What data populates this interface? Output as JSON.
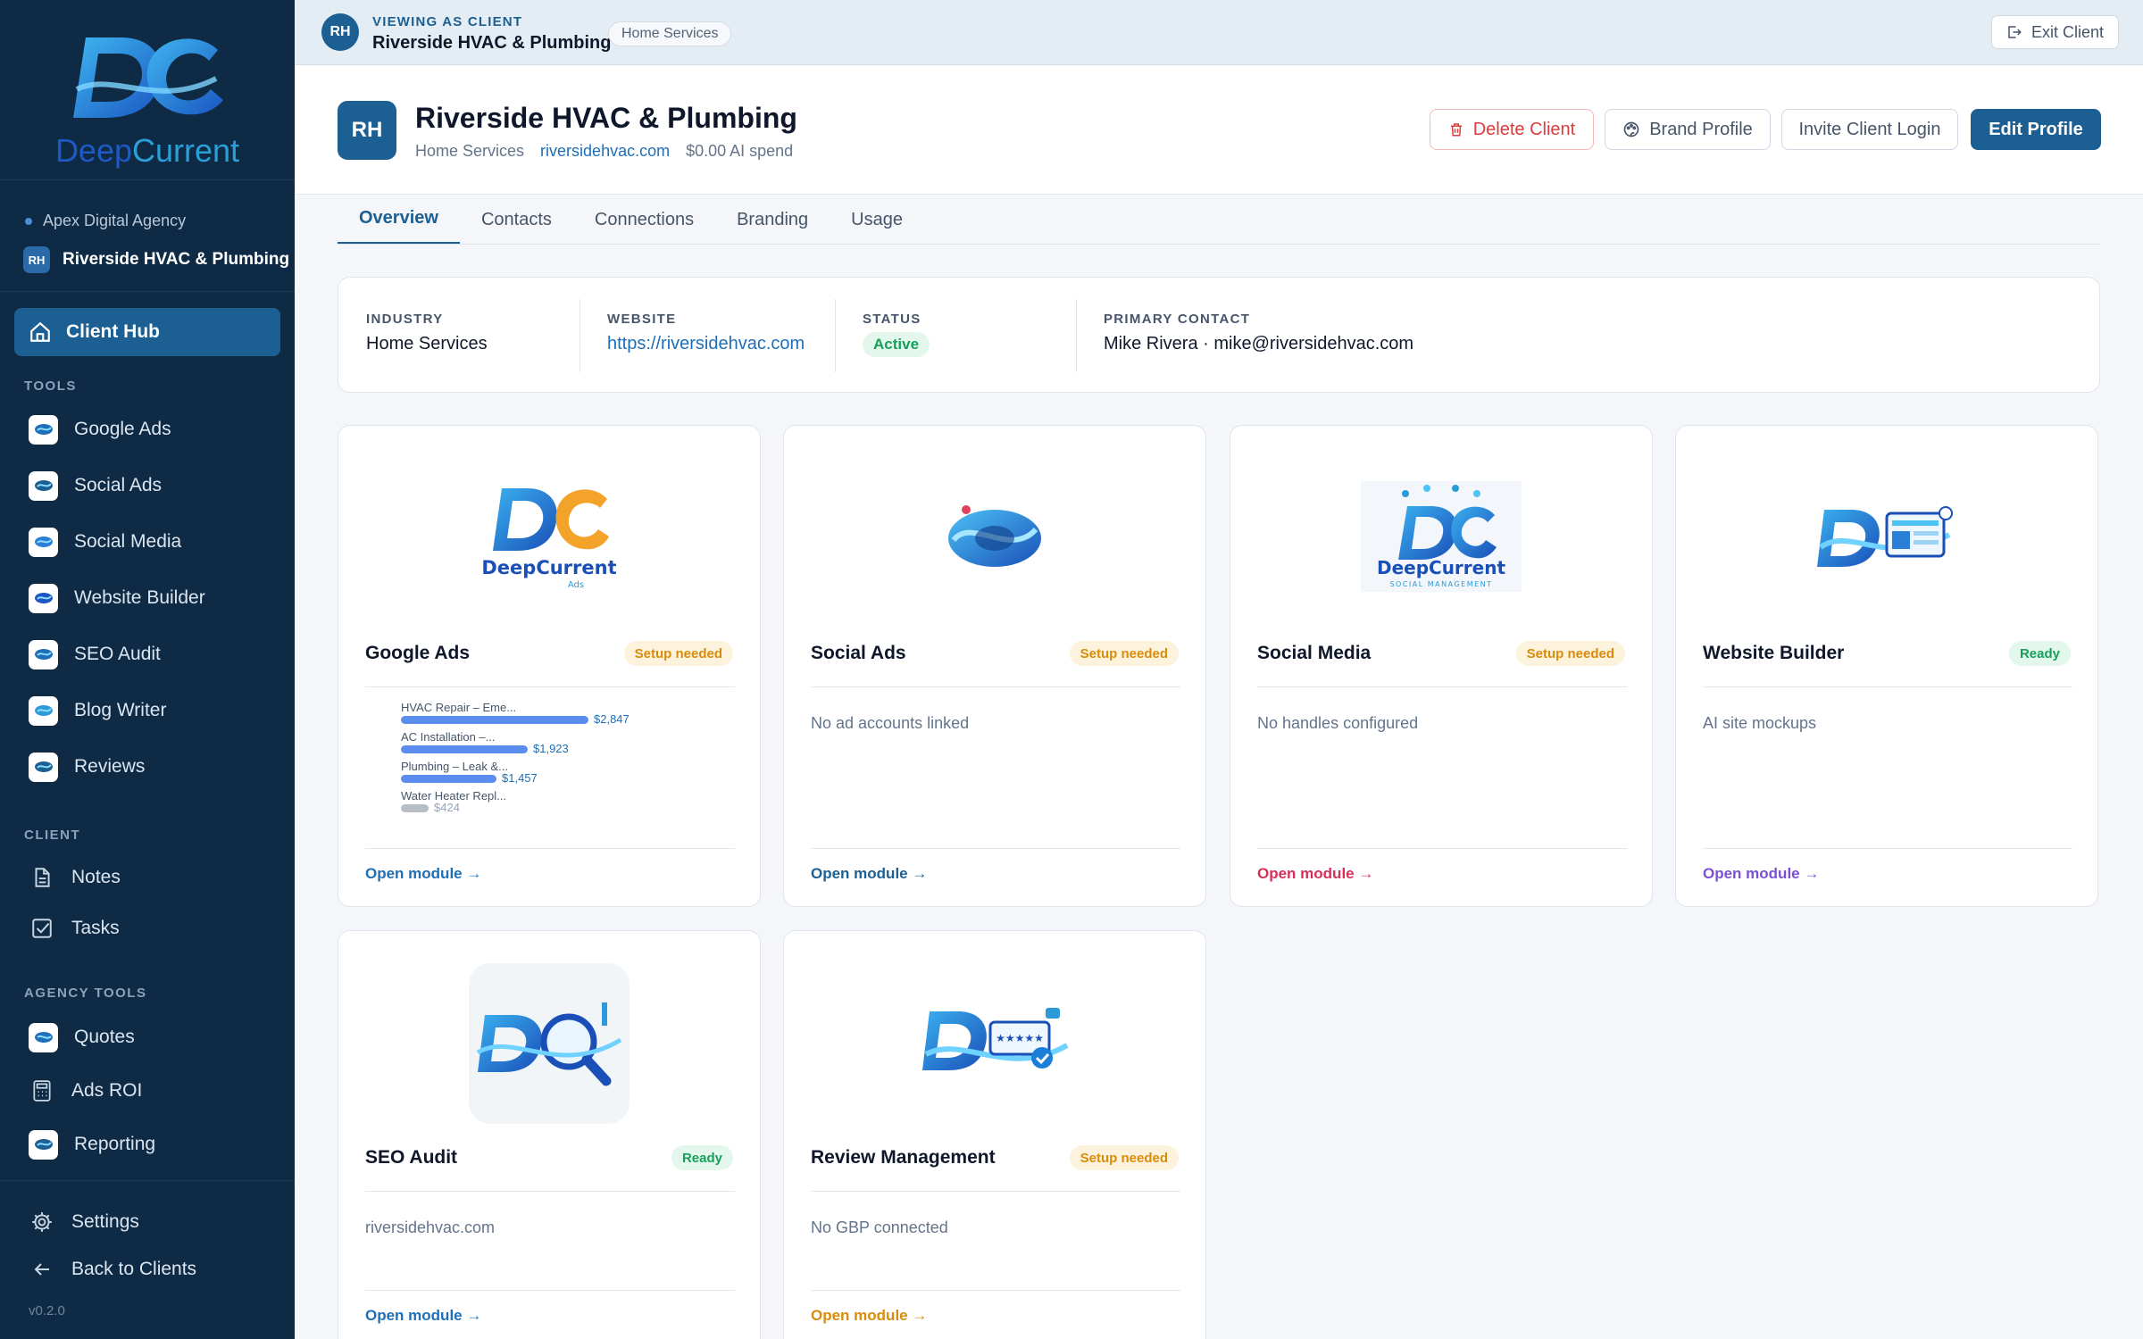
{
  "sidebar": {
    "logo_text_deep": "Deep",
    "logo_text_current": "Current",
    "agency": "Apex Digital Agency",
    "client_initials": "RH",
    "client_name": "Riverside HVAC & Plumbing",
    "hub_label": "Client Hub",
    "tools_label": "TOOLS",
    "tools": [
      {
        "label": "Google Ads",
        "icon": "google-ads-app-icon"
      },
      {
        "label": "Social Ads",
        "icon": "social-ads-app-icon"
      },
      {
        "label": "Social Media",
        "icon": "social-media-app-icon"
      },
      {
        "label": "Website Builder",
        "icon": "website-builder-app-icon"
      },
      {
        "label": "SEO Audit",
        "icon": "seo-audit-app-icon"
      },
      {
        "label": "Blog Writer",
        "icon": "blog-writer-app-icon"
      },
      {
        "label": "Reviews",
        "icon": "reviews-app-icon"
      }
    ],
    "client_label": "CLIENT",
    "client_items": [
      {
        "label": "Notes",
        "icon": "document-icon"
      },
      {
        "label": "Tasks",
        "icon": "checkbox-icon"
      }
    ],
    "agency_tools_label": "AGENCY TOOLS",
    "agency_items": [
      {
        "label": "Quotes",
        "icon": "quotes-app-icon"
      },
      {
        "label": "Ads ROI",
        "icon": "calculator-icon"
      },
      {
        "label": "Reporting",
        "icon": "reporting-app-icon"
      }
    ],
    "settings_label": "Settings",
    "back_label": "Back to Clients",
    "version": "v0.2.0"
  },
  "banner": {
    "initials": "RH",
    "viewing_label": "VIEWING AS CLIENT",
    "client_name": "Riverside HVAC & Plumbing",
    "tag": "Home Services",
    "exit_label": "Exit Client"
  },
  "header": {
    "initials": "RH",
    "title": "Riverside HVAC & Plumbing",
    "industry": "Home Services",
    "domain": "riversidehvac.com",
    "ai_spend": "$0.00 AI spend",
    "delete_label": "Delete Client",
    "brand_label": "Brand Profile",
    "invite_label": "Invite Client Login",
    "edit_label": "Edit Profile"
  },
  "tabs": [
    "Overview",
    "Contacts",
    "Connections",
    "Branding",
    "Usage"
  ],
  "info": {
    "industry_label": "INDUSTRY",
    "industry": "Home Services",
    "website_label": "WEBSITE",
    "website": "https://riversidehvac.com",
    "status_label": "STATUS",
    "status": "Active",
    "contact_label": "PRIMARY CONTACT",
    "contact": "Mike Rivera · mike@riversidehvac.com"
  },
  "modules": [
    {
      "name": "Google Ads",
      "status": "Setup needed",
      "desc": "",
      "open": "Open module →",
      "accent": "#1c6fb8"
    },
    {
      "name": "Social Ads",
      "status": "Setup needed",
      "desc": "No ad accounts linked",
      "open": "Open module →",
      "accent": "#1c5f92"
    },
    {
      "name": "Social Media",
      "status": "Setup needed",
      "desc": "No handles configured",
      "open": "Open module →",
      "accent": "#d6305a"
    },
    {
      "name": "Website Builder",
      "status": "Ready",
      "desc": "AI site mockups",
      "open": "Open module →",
      "accent": "#7c4fd6"
    },
    {
      "name": "SEO Audit",
      "status": "Ready",
      "desc": "riversidehvac.com",
      "open": "Open module →",
      "accent": "#1c6fb8"
    },
    {
      "name": "Review Management",
      "status": "Setup needed",
      "desc": "No GBP connected",
      "open": "Open module →",
      "accent": "#d98c0b"
    }
  ],
  "logo_labels": {
    "ads_brand": "DeepCurrent",
    "ads_sub": "Ads",
    "social_brand": "DeepCurrent",
    "social_sub": "SOCIAL MANAGEMENT"
  },
  "ads_campaigns": [
    {
      "label": "HVAC Repair – Eme...",
      "value": "$2,847",
      "amount": 2847,
      "color": "#5b8def"
    },
    {
      "label": "AC Installation –...",
      "value": "$1,923",
      "amount": 1923,
      "color": "#5b8def"
    },
    {
      "label": "Plumbing – Leak &...",
      "value": "$1,457",
      "amount": 1457,
      "color": "#5b8def"
    },
    {
      "label": "Water Heater Repl...",
      "value": "$424",
      "amount": 424,
      "color": "#b8bec7"
    }
  ]
}
